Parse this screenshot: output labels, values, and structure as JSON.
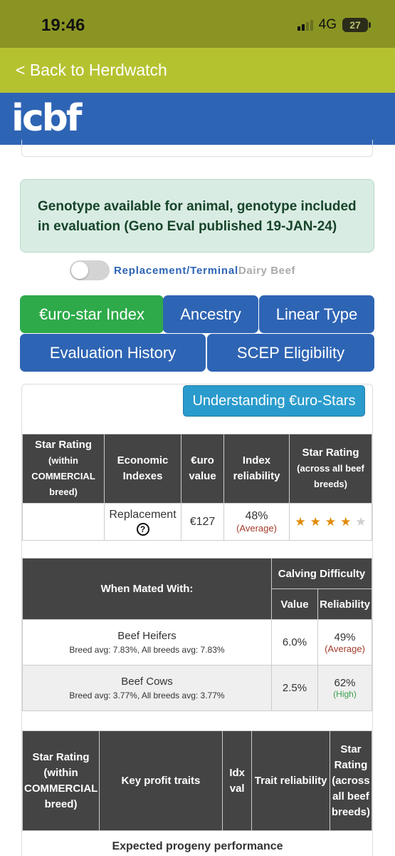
{
  "status_bar": {
    "time": "19:46",
    "network": "4G",
    "battery": "27"
  },
  "nav": {
    "back_label": "< Back to Herdwatch",
    "logo_text": "icbf"
  },
  "alert": {
    "message": "Genotype available for animal, genotype included in evaluation (Geno Eval published 19-JAN-24)"
  },
  "toggle": {
    "on_label": "Replacement/Terminal",
    "off_label": "Dairy Beef",
    "enabled": false
  },
  "tabs": [
    {
      "label": "€uro-star Index",
      "active": true
    },
    {
      "label": "Ancestry",
      "active": false
    },
    {
      "label": "Linear Type",
      "active": false
    },
    {
      "label": "Evaluation History",
      "active": false
    },
    {
      "label": "SCEP Eligibility",
      "active": false
    }
  ],
  "understanding_button": "Understanding €uro-Stars",
  "index_table": {
    "headers": {
      "star_rating_commercial_l1": "Star Rating",
      "star_rating_commercial_l2": "(within COMMERCIAL breed)",
      "economic_indexes": "Economic Indexes",
      "euro_value": "€uro value",
      "index_reliability": "Index reliability",
      "star_rating_all_l1": "Star Rating",
      "star_rating_all_l2": "(across all beef breeds)"
    },
    "row": {
      "index": "Replacement",
      "help_icon": "?",
      "value": "€127",
      "reliability": "48%",
      "reliability_label": "(Average)",
      "stars_filled": 4,
      "stars_total": 5
    }
  },
  "calving_table": {
    "headers": {
      "mated_with": "When Mated With:",
      "calving_difficulty": "Calving Difficulty",
      "value": "Value",
      "reliability": "Reliability"
    },
    "rows": [
      {
        "name": "Beef Heifers",
        "sub": "Breed avg: 7.83%, All breeds avg: 7.83%",
        "value": "6.0%",
        "reliability": "49%",
        "reliability_label": "(Average)"
      },
      {
        "name": "Beef Cows",
        "sub": "Breed avg: 3.77%, All breeds avg: 3.77%",
        "value": "2.5%",
        "reliability": "62%",
        "reliability_label": "(High)"
      }
    ]
  },
  "traits_table": {
    "headers": {
      "star_rating_commercial": "Star Rating (within COMMERCIAL breed)",
      "key_profit_traits": "Key profit traits",
      "idx_val": "Idx val",
      "trait_reliability": "Trait reliability",
      "star_rating_all": "Star Rating (across all beef breeds)"
    },
    "caption": "Expected progeny performance"
  },
  "colors": {
    "status_bar": "#8a9423",
    "back_bar": "#b5c230",
    "brand": "#2e64b4",
    "tab_active": "#2eaa4a",
    "star": "#e08a00",
    "header_dark": "#444444"
  }
}
